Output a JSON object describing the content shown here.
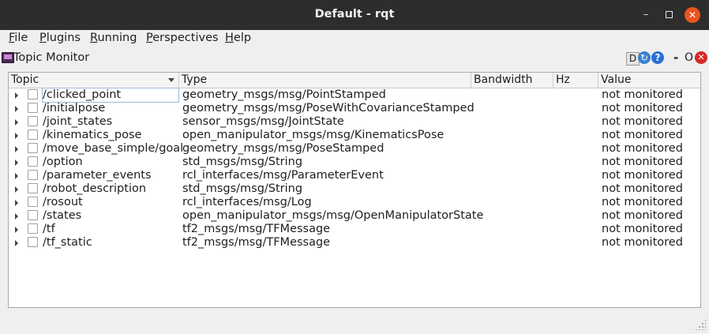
{
  "window": {
    "title": "Default - rqt",
    "minimize_glyph": "–",
    "close_glyph": "✕"
  },
  "menu": [
    {
      "label_first": "F",
      "label_rest": "ile"
    },
    {
      "label_first": "P",
      "label_rest": "lugins"
    },
    {
      "label_first": "R",
      "label_rest": "unning"
    },
    {
      "label_first": "P",
      "label_rest": "erspectives"
    },
    {
      "label_first": "H",
      "label_rest": "elp"
    }
  ],
  "dock": {
    "title": "Topic Monitor",
    "d_label": "D",
    "refresh_glyph": "↻",
    "help_glyph": "?",
    "dash_label": "-",
    "o_label": "O",
    "close_glyph": "✕"
  },
  "columns": {
    "topic": "Topic",
    "type": "Type",
    "bandwidth": "Bandwidth",
    "hz": "Hz",
    "value": "Value"
  },
  "rows": [
    {
      "topic": "/clicked_point",
      "type": "geometry_msgs/msg/PointStamped",
      "value": "not monitored"
    },
    {
      "topic": "/initialpose",
      "type": "geometry_msgs/msg/PoseWithCovarianceStamped",
      "value": "not monitored"
    },
    {
      "topic": "/joint_states",
      "type": "sensor_msgs/msg/JointState",
      "value": "not monitored"
    },
    {
      "topic": "/kinematics_pose",
      "type": "open_manipulator_msgs/msg/KinematicsPose",
      "value": "not monitored"
    },
    {
      "topic": "/move_base_simple/goal",
      "type": "geometry_msgs/msg/PoseStamped",
      "value": "not monitored"
    },
    {
      "topic": "/option",
      "type": "std_msgs/msg/String",
      "value": "not monitored"
    },
    {
      "topic": "/parameter_events",
      "type": "rcl_interfaces/msg/ParameterEvent",
      "value": "not monitored"
    },
    {
      "topic": "/robot_description",
      "type": "std_msgs/msg/String",
      "value": "not monitored"
    },
    {
      "topic": "/rosout",
      "type": "rcl_interfaces/msg/Log",
      "value": "not monitored"
    },
    {
      "topic": "/states",
      "type": "open_manipulator_msgs/msg/OpenManipulatorState",
      "value": "not monitored"
    },
    {
      "topic": "/tf",
      "type": "tf2_msgs/msg/TFMessage",
      "value": "not monitored"
    },
    {
      "topic": "/tf_static",
      "type": "tf2_msgs/msg/TFMessage",
      "value": "not monitored"
    }
  ]
}
